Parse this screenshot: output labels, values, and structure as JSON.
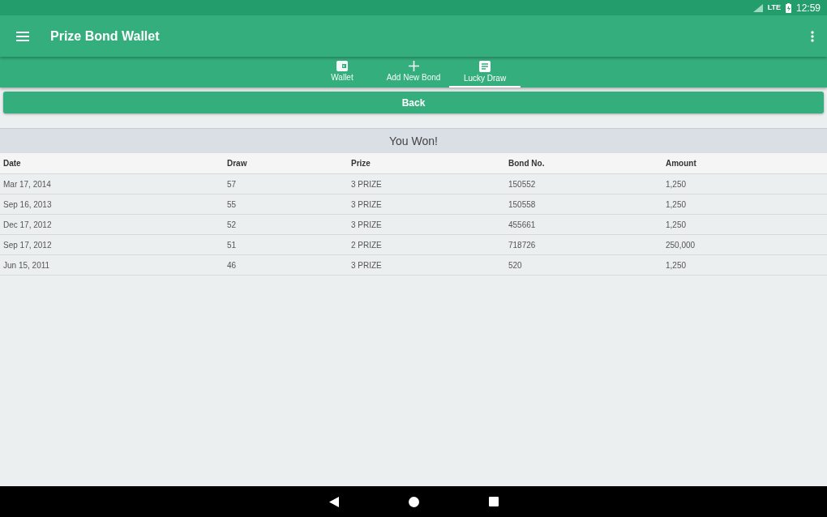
{
  "status_bar": {
    "network": "LTE",
    "time": "12:59"
  },
  "app_bar": {
    "title": "Prize Bond Wallet"
  },
  "tabs": [
    {
      "label": "Wallet",
      "kind": "wallet",
      "selected": false
    },
    {
      "label": "Add New Bond",
      "kind": "add",
      "selected": false
    },
    {
      "label": "Lucky Draw",
      "kind": "list",
      "selected": true
    }
  ],
  "back_button": "Back",
  "table": {
    "title": "You Won!",
    "columns": [
      "Date",
      "Draw",
      "Prize",
      "Bond No.",
      "Amount"
    ],
    "rows": [
      [
        "Mar 17, 2014",
        "57",
        "3 PRIZE",
        "150552",
        "1,250"
      ],
      [
        "Sep 16, 2013",
        "55",
        "3 PRIZE",
        "150558",
        "1,250"
      ],
      [
        "Dec 17, 2012",
        "52",
        "3 PRIZE",
        "455661",
        "1,250"
      ],
      [
        "Sep 17, 2012",
        "51",
        "2 PRIZE",
        "718726",
        "250,000"
      ],
      [
        "Jun 15, 2011",
        "46",
        "3 PRIZE",
        "520",
        "1,250"
      ]
    ]
  }
}
